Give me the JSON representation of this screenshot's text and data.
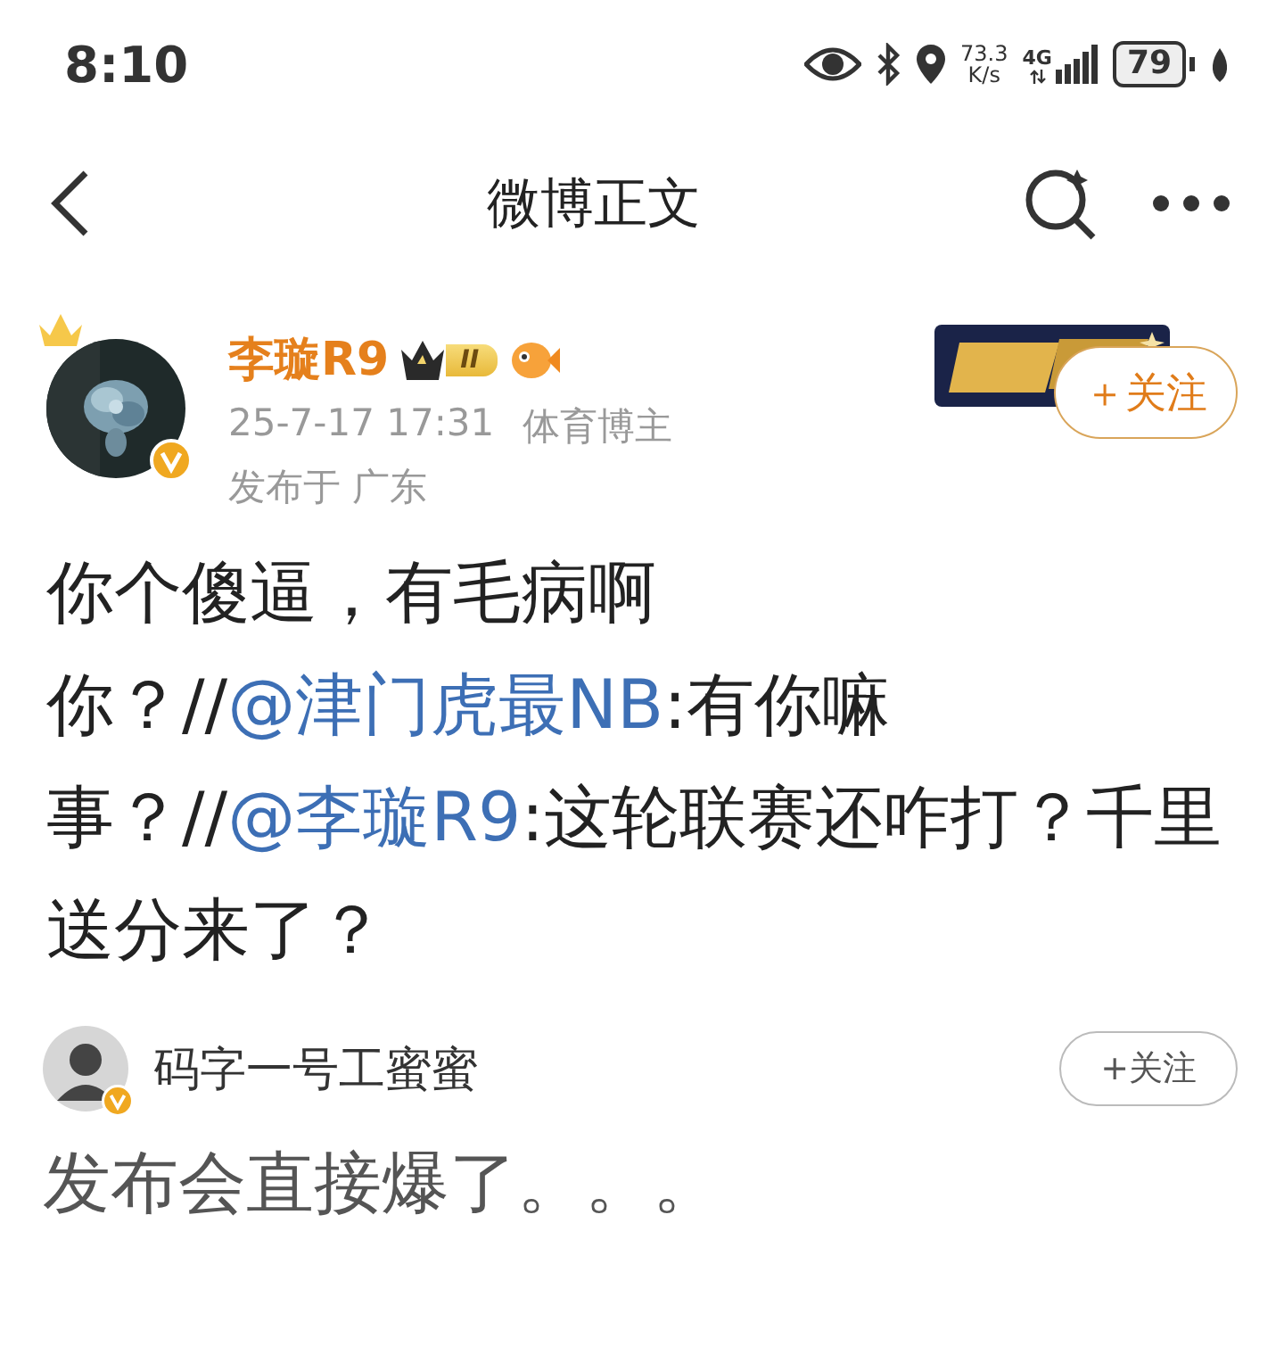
{
  "status_bar": {
    "time": "8:10",
    "speed_value": "73.3",
    "speed_unit": "K/s",
    "network": "4G",
    "battery": "79"
  },
  "header": {
    "title": "微博正文"
  },
  "post": {
    "author": "李璇R9",
    "level_badge": "II",
    "timestamp": "25-7-17 17:31",
    "category": "体育博主",
    "location": "发布于 广东",
    "follow_button": "＋关注",
    "body": [
      {
        "kind": "text",
        "text": "你个傻逼，有毛病啊你？//"
      },
      {
        "kind": "mention",
        "text": "@津门虎最NB"
      },
      {
        "kind": "text",
        "text": ":有你嘛事？//"
      },
      {
        "kind": "mention",
        "text": "@李璇R9"
      },
      {
        "kind": "text",
        "text": ":这轮联赛还咋打？千里送分来了？"
      }
    ]
  },
  "comment": {
    "author": "码字一号工蜜蜜",
    "follow_button": "+关注",
    "text": "发布会直接爆了。。。"
  }
}
